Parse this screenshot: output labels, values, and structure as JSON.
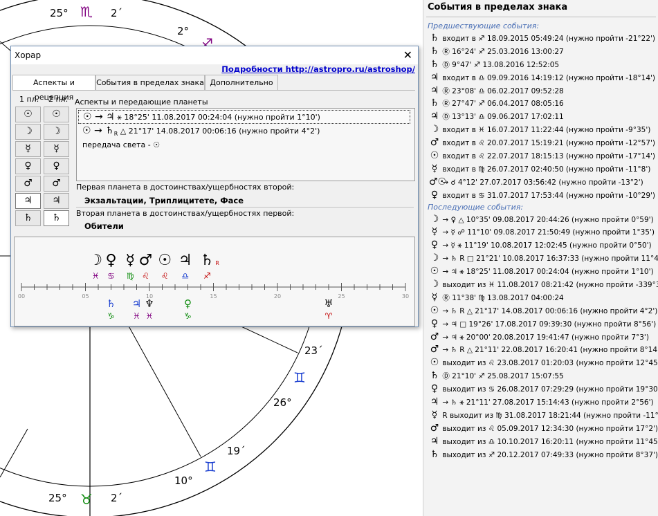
{
  "wheel": {
    "degrees": {
      "d25_top": "25°",
      "d2_top": "2´",
      "d2b": "2°",
      "d23": "23´",
      "d26": "26°",
      "d19": "19´",
      "d10": "10°",
      "d25_bot": "25°",
      "d2_bot": "2´"
    },
    "signs": {
      "scorpio": "♏",
      "sag": "♐",
      "gemini_a": "♊",
      "gemini_b": "♊",
      "taurus": "♉"
    },
    "colors": {
      "scorpio": "#800080",
      "sag": "#800080",
      "gemini": "#1a3fd0",
      "taurus": "#0a8a0a"
    }
  },
  "dialog": {
    "title": "Хорар",
    "close": "✕",
    "link": "Подробности http://astropro.ru/astroshop/",
    "tabs": [
      "Аспекты и рецепция",
      "События в пределах знака",
      "Дополнительно"
    ],
    "col1": "1 пл.",
    "col2": "2 пл.",
    "planets": [
      "☉",
      "☽",
      "☿",
      "♀",
      "♂",
      "♃",
      "♄"
    ],
    "aspects_title": "Аспекты и передающие планеты",
    "aspect_rows": [
      {
        "glyphs": "☉ → ♃",
        "text": " ⚹ 18°25' 11.08.2017 00:24:04 (нужно пройти 1°10')"
      },
      {
        "glyphs": "☉ → ♄",
        "retro": "R",
        "text": " △ 21°17' 14.08.2017 00:06:16 (нужно пройти 4°2')"
      },
      {
        "glyphs": "",
        "text": "передача света - ☉"
      }
    ],
    "first_label": "Первая планета в достоинствах/ущербностях второй:",
    "first_value": "Экзальтации, Триплицитете, Фасе",
    "second_label": "Вторая планета в достоинствах/ущербностях первой:",
    "second_value": "Обители"
  },
  "timeline": {
    "ticks": [
      "00",
      "05",
      "10",
      "15",
      "20",
      "25",
      "30"
    ],
    "upper": [
      {
        "p": "☽",
        "s": "♓",
        "pos": 5.8,
        "pc": "#000",
        "sc": "#800080"
      },
      {
        "p": "♀",
        "s": "♋",
        "pos": 7.0,
        "pc": "#000",
        "sc": "#800080"
      },
      {
        "p": "☿",
        "s": "♍",
        "pos": 8.5,
        "pc": "#000",
        "sc": "#0a8a0a"
      },
      {
        "p": "♂",
        "s": "♌",
        "pos": 9.7,
        "pc": "#000",
        "sc": "#c00000"
      },
      {
        "p": "☉",
        "s": "♌",
        "pos": 11.2,
        "pc": "#000",
        "sc": "#c00000"
      },
      {
        "p": "♃",
        "s": "♎",
        "pos": 12.8,
        "pc": "#000",
        "sc": "#1a3fd0"
      },
      {
        "p": "♄",
        "s": "♐",
        "pos": 14.5,
        "pc": "#000",
        "sc": "#c00000",
        "r": "R"
      }
    ],
    "lower": [
      {
        "p": "♄",
        "s": "♑",
        "pos": 7.0,
        "pc": "#1a3fd0",
        "sc": "#0a8a0a"
      },
      {
        "p": "♃",
        "s": "♓",
        "pos": 9.0,
        "pc": "#1a3fd0",
        "sc": "#800080"
      },
      {
        "p": "♆",
        "s": "♓",
        "pos": 10.0,
        "pc": "#000",
        "sc": "#800080"
      },
      {
        "p": "♀",
        "s": "♑",
        "pos": 13.0,
        "pc": "#0a8a0a",
        "sc": "#0a8a0a"
      },
      {
        "p": "♅",
        "s": "♈",
        "pos": 24.0,
        "pc": "#000",
        "sc": "#c00000"
      }
    ]
  },
  "panel": {
    "title": "События в пределах знака",
    "prev_label": "Предшествующие события:",
    "next_label": "Последующие события:",
    "prev": [
      {
        "g": "♄",
        "t": " входит в ♐ 18.09.2015 05:49:24 (нужно пройти -21°22')"
      },
      {
        "g": "♄",
        "t": " Ⓡ 16°24' ♐ 25.03.2016 13:00:27"
      },
      {
        "g": "♄",
        "t": " Ⓓ 9°47' ♐ 13.08.2016 12:52:05"
      },
      {
        "g": "♃",
        "t": " входит в ♎ 09.09.2016 14:19:12 (нужно пройти -18°14')"
      },
      {
        "g": "♃",
        "t": " Ⓡ 23°08' ♎ 06.02.2017 09:52:28"
      },
      {
        "g": "♄",
        "t": " Ⓡ 27°47' ♐ 06.04.2017 08:05:16"
      },
      {
        "g": "♃",
        "t": " Ⓓ 13°13' ♎ 09.06.2017 17:02:11"
      },
      {
        "g": "☽",
        "t": " входит в ♓ 16.07.2017 11:22:44 (нужно пройти -9°35')"
      },
      {
        "g": "♂",
        "t": " входит в ♌ 20.07.2017 15:19:21 (нужно пройти -12°57')"
      },
      {
        "g": "☉",
        "t": " входит в ♌ 22.07.2017 18:15:13 (нужно пройти -17°14')"
      },
      {
        "g": "☿",
        "t": " входит в ♍ 26.07.2017 02:40:50 (нужно пройти -11°8')"
      },
      {
        "g": "♂☉",
        "t": " → ☌ 4°12' 27.07.2017 03:56:42 (нужно пройти -13°2')"
      },
      {
        "g": "♀",
        "t": " входит в ♋ 31.07.2017 17:53:44 (нужно пройти -10°29')"
      }
    ],
    "next": [
      {
        "g": "☽",
        "t": " → ♀ △ 10°35' 09.08.2017 20:44:26 (нужно пройти 0°59')"
      },
      {
        "g": "☿",
        "t": " → ☿ ☍ 11°10' 09.08.2017 21:50:49 (нужно пройти 1°35')"
      },
      {
        "g": "♀",
        "t": " → ☿ ⚹ 11°19' 10.08.2017 12:02:45 (нужно пройти 0°50')"
      },
      {
        "g": "☽",
        "t": " → ♄ R □ 21°21' 10.08.2017 16:37:33 (нужно пройти 11°46')"
      },
      {
        "g": "☉",
        "t": " → ♃ ⚹ 18°25' 11.08.2017 00:24:04 (нужно пройти 1°10')"
      },
      {
        "g": "☽",
        "t": " выходит из ♓ 11.08.2017 08:21:42 (нужно пройти -339°35')"
      },
      {
        "g": "☿",
        "t": " Ⓡ 11°38' ♍ 13.08.2017 04:00:24"
      },
      {
        "g": "☉",
        "t": " → ♄ R △ 21°17' 14.08.2017 00:06:16 (нужно пройти 4°2')"
      },
      {
        "g": "♀",
        "t": " → ♃ □ 19°26' 17.08.2017 09:39:30 (нужно пройти 8°56')"
      },
      {
        "g": "♂",
        "t": " → ♃ ⚹ 20°00' 20.08.2017 19:41:47 (нужно пройти 7°3')"
      },
      {
        "g": "♂",
        "t": " → ♄ R △ 21°11' 22.08.2017 16:20:41 (нужно пройти 8°14')"
      },
      {
        "g": "☉",
        "t": " выходит из ♌ 23.08.2017 01:20:03 (нужно пройти 12°45')"
      },
      {
        "g": "♄",
        "t": " Ⓓ 21°10' ♐ 25.08.2017 15:07:55"
      },
      {
        "g": "♀",
        "t": " выходит из ♋ 26.08.2017 07:29:29 (нужно пройти 19°30')"
      },
      {
        "g": "♃",
        "t": " → ♄ ⚹ 21°11' 27.08.2017 15:14:43 (нужно пройти 2°56')"
      },
      {
        "g": "☿",
        "t": " R выходит из ♍ 31.08.2017 18:21:44 (нужно пройти -11°8')"
      },
      {
        "g": "♂",
        "t": " выходит из ♌ 05.09.2017 12:34:30 (нужно пройти 17°2')"
      },
      {
        "g": "♃",
        "t": " выходит из ♎ 10.10.2017 16:20:11 (нужно пройти 11°45')"
      },
      {
        "g": "♄",
        "t": " выходит из ♐ 20.12.2017 07:49:33 (нужно пройти 8°37')"
      }
    ]
  }
}
